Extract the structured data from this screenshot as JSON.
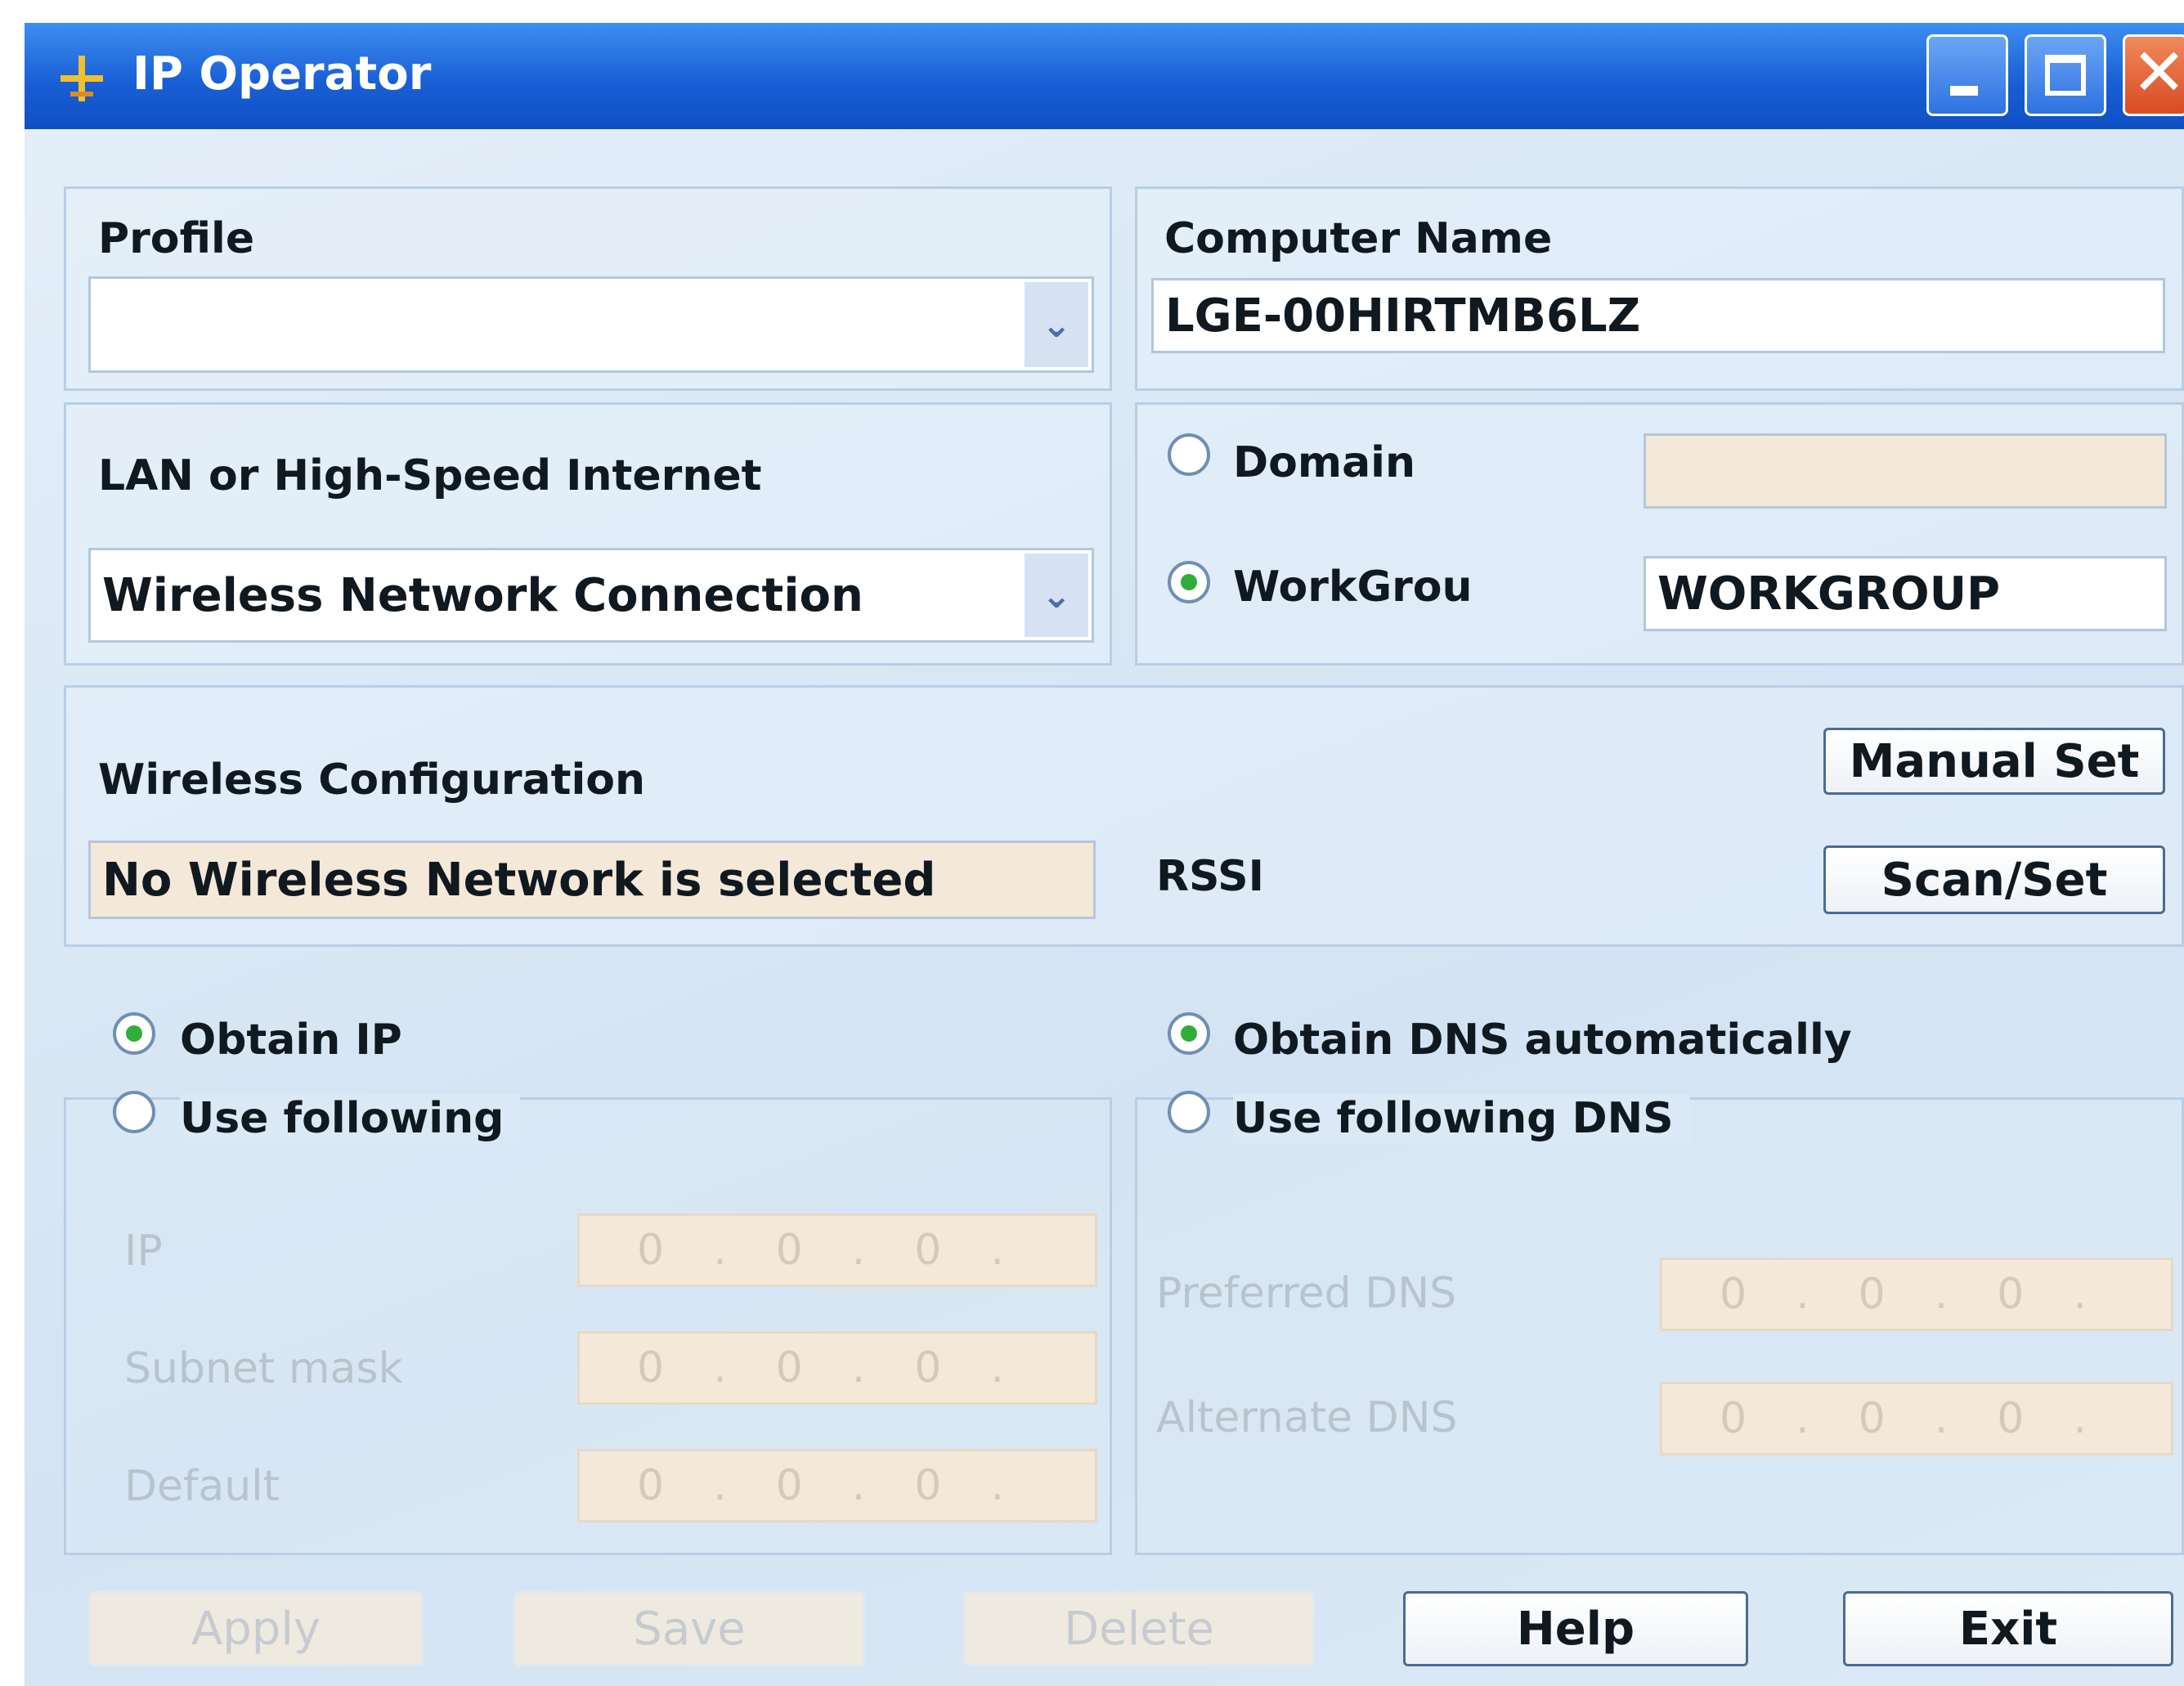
{
  "window": {
    "title": "IP Operator",
    "app_icon": "network-icon"
  },
  "titlebar_buttons": {
    "minimize": "minimize-icon",
    "maximize": "maximize-icon",
    "close": "close-icon"
  },
  "profile": {
    "label": "Profile",
    "value": ""
  },
  "computer_name": {
    "label": "Computer Name",
    "value": "LGE-00HIRTMB6LZ"
  },
  "lan": {
    "label": "LAN or High-Speed Internet",
    "value": "Wireless Network Connection"
  },
  "domain": {
    "label": "Domain",
    "value": "",
    "selected": false
  },
  "workgroup": {
    "label": "WorkGrou",
    "value": "WORKGROUP",
    "selected": true
  },
  "wireless": {
    "label": "Wireless Configuration",
    "status": "No Wireless Network is selected",
    "rssi_label": "RSSI",
    "manual_set": "Manual Set",
    "scan_set": "Scan/Set"
  },
  "ip_config": {
    "obtain_label": "Obtain IP",
    "use_following_label": "Use following",
    "ip_label": "IP",
    "subnet_label": "Subnet mask",
    "gateway_label": "Default",
    "ip_value": [
      "0",
      "0",
      "0"
    ],
    "subnet_value": [
      "0",
      "0",
      "0"
    ],
    "gateway_value": [
      "0",
      "0",
      "0"
    ]
  },
  "dns_config": {
    "obtain_label": "Obtain DNS automatically",
    "use_following_label": "Use following DNS",
    "preferred_label": "Preferred DNS",
    "alternate_label": "Alternate DNS",
    "preferred_value": [
      "0",
      "0",
      "0"
    ],
    "alternate_value": [
      "0",
      "0",
      "0"
    ]
  },
  "buttons": {
    "apply": "Apply",
    "save": "Save",
    "delete": "Delete",
    "help": "Help",
    "exit": "Exit"
  }
}
